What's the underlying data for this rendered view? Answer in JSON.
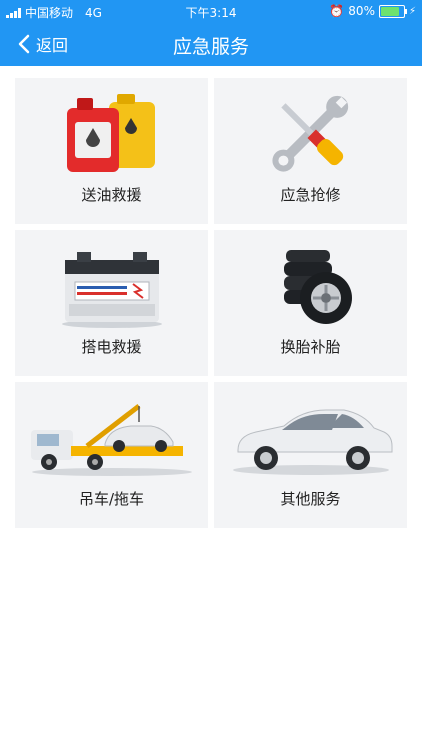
{
  "status": {
    "carrier": "中国移动",
    "network": "4G",
    "time": "下午3:14",
    "battery": "80%"
  },
  "nav": {
    "back_label": "返回",
    "title": "应急服务"
  },
  "services": [
    {
      "label": "送油救援",
      "icon": "oil-can-icon"
    },
    {
      "label": "应急抢修",
      "icon": "wrench-screwdriver-icon"
    },
    {
      "label": "搭电救援",
      "icon": "car-battery-icon"
    },
    {
      "label": "换胎补胎",
      "icon": "tires-icon"
    },
    {
      "label": "吊车/拖车",
      "icon": "tow-truck-icon"
    },
    {
      "label": "其他服务",
      "icon": "car-icon"
    }
  ],
  "colors": {
    "header": "#2196f3",
    "card_bg": "#f3f4f6"
  }
}
